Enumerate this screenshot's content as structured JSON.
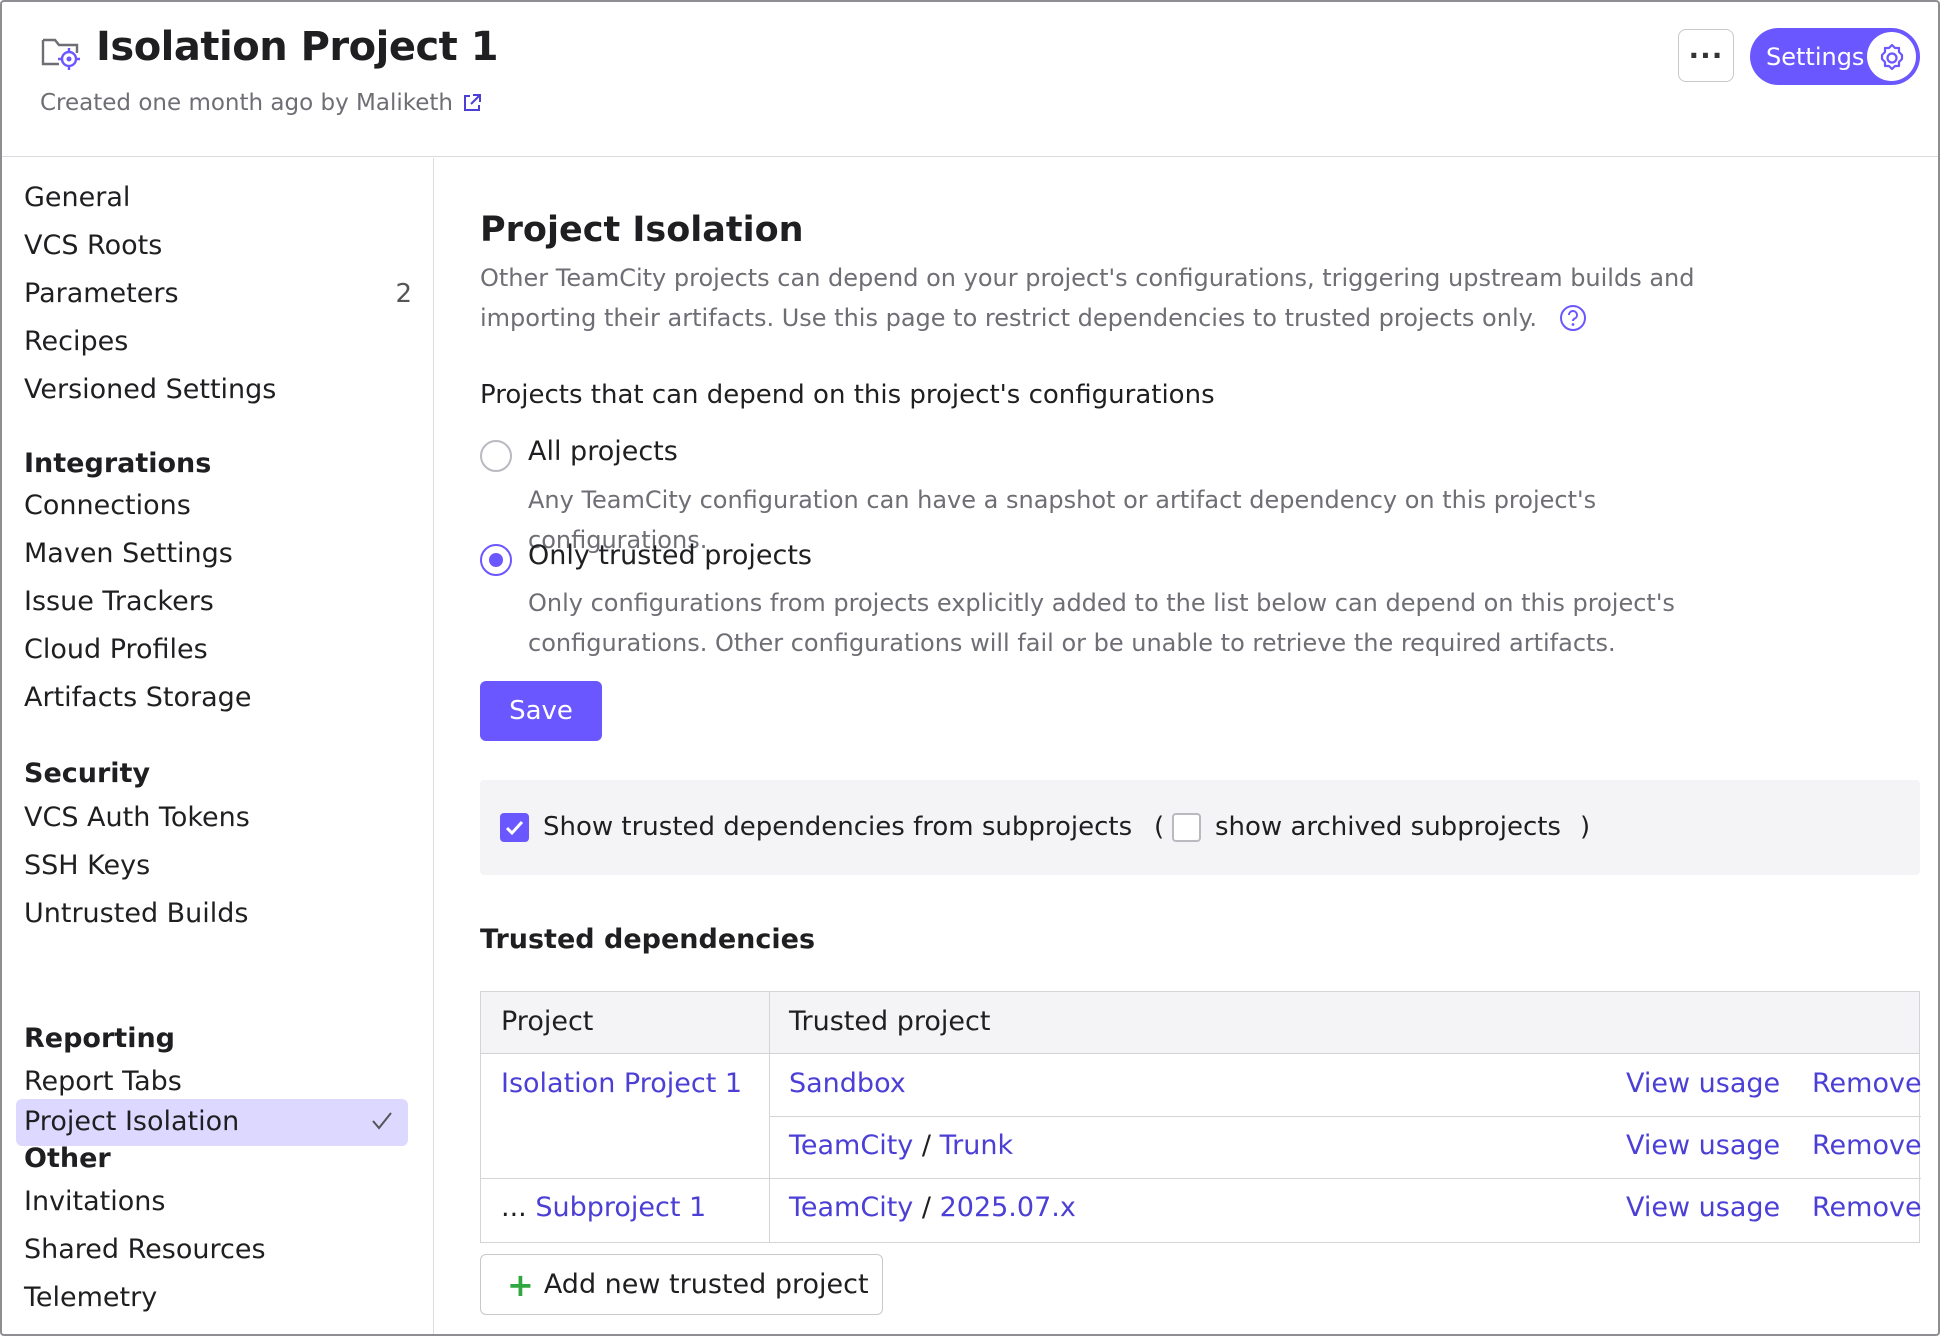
{
  "header": {
    "title": "Isolation Project 1",
    "subtitle": "Created one month ago by Maliketh",
    "more_label": "···",
    "settings_label": "Settings"
  },
  "sidebar": {
    "items_top": [
      {
        "label": "General"
      },
      {
        "label": "VCS Roots"
      },
      {
        "label": "Parameters",
        "count": "2"
      },
      {
        "label": "Recipes"
      },
      {
        "label": "Versioned Settings"
      }
    ],
    "sections": [
      {
        "title": "Integrations",
        "items": [
          "Connections",
          "Maven Settings",
          "Issue Trackers",
          "Cloud Profiles",
          "Artifacts Storage"
        ]
      },
      {
        "title": "Security",
        "items": [
          "VCS Auth Tokens",
          "SSH Keys",
          "Untrusted Builds",
          "Project Isolation"
        ]
      },
      {
        "title": "Reporting",
        "items": [
          "Report Tabs"
        ]
      },
      {
        "title": "Other",
        "items": [
          "Invitations",
          "Shared Resources",
          "Telemetry"
        ]
      }
    ],
    "active": "Project Isolation"
  },
  "main": {
    "heading": "Project Isolation",
    "description": "Other TeamCity projects can depend on your project's configurations, triggering upstream builds and importing their artifacts. Use this page to restrict dependencies to trusted projects only.",
    "group_label": "Projects that can depend on this project's configurations",
    "options": [
      {
        "label": "All projects",
        "desc": "Any TeamCity configuration can have a snapshot or artifact dependency on this project's configurations.",
        "checked": false
      },
      {
        "label": "Only trusted projects",
        "desc": "Only configurations from projects explicitly added to the list below can depend on this project's configurations. Other configurations will fail or be unable to retrieve the required artifacts.",
        "checked": true
      }
    ],
    "save_label": "Save",
    "filter": {
      "show_subprojects_label": "Show trusted dependencies from subprojects",
      "show_subprojects_checked": true,
      "paren_open": "(",
      "show_archived_label": "show archived subprojects",
      "show_archived_checked": false,
      "paren_close": ")"
    },
    "trusted_heading": "Trusted dependencies",
    "table": {
      "headers": [
        "Project",
        "Trusted project"
      ],
      "rows": [
        {
          "project": "Isolation Project 1",
          "project_prefix": "",
          "trusted_a": "Sandbox",
          "trusted_sep": "",
          "trusted_b": ""
        },
        {
          "project": "",
          "project_prefix": "",
          "trusted_a": "TeamCity",
          "trusted_sep": "/",
          "trusted_b": "Trunk"
        },
        {
          "project": "Subproject 1",
          "project_prefix": "...",
          "trusted_a": "TeamCity",
          "trusted_sep": "/",
          "trusted_b": "2025.07.x"
        }
      ],
      "view_usage_label": "View usage",
      "remove_label": "Remove"
    },
    "add_label": "Add new trusted project"
  },
  "colors": {
    "accent": "#6b57ff",
    "link": "#4b3fd6",
    "active_bg": "#dcd8ff"
  }
}
